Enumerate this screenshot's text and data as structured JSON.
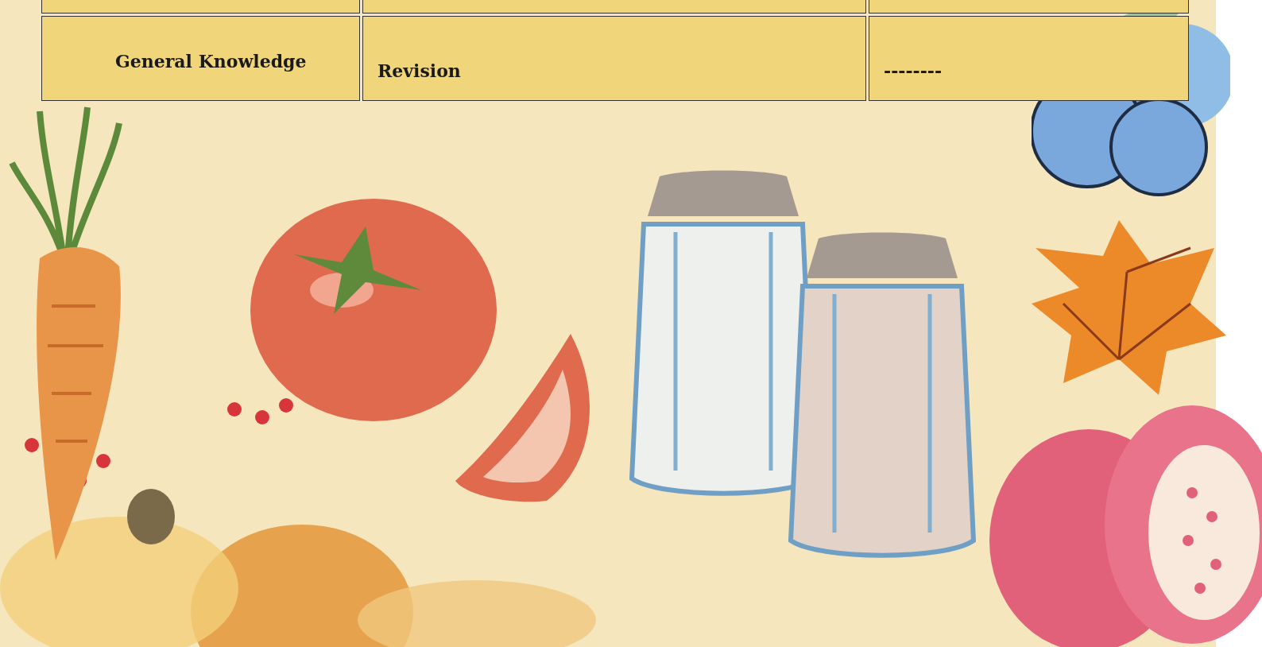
{
  "table": {
    "rows": [
      {
        "cells": [
          "General Knowledge",
          "Revision",
          "--------"
        ]
      }
    ]
  }
}
